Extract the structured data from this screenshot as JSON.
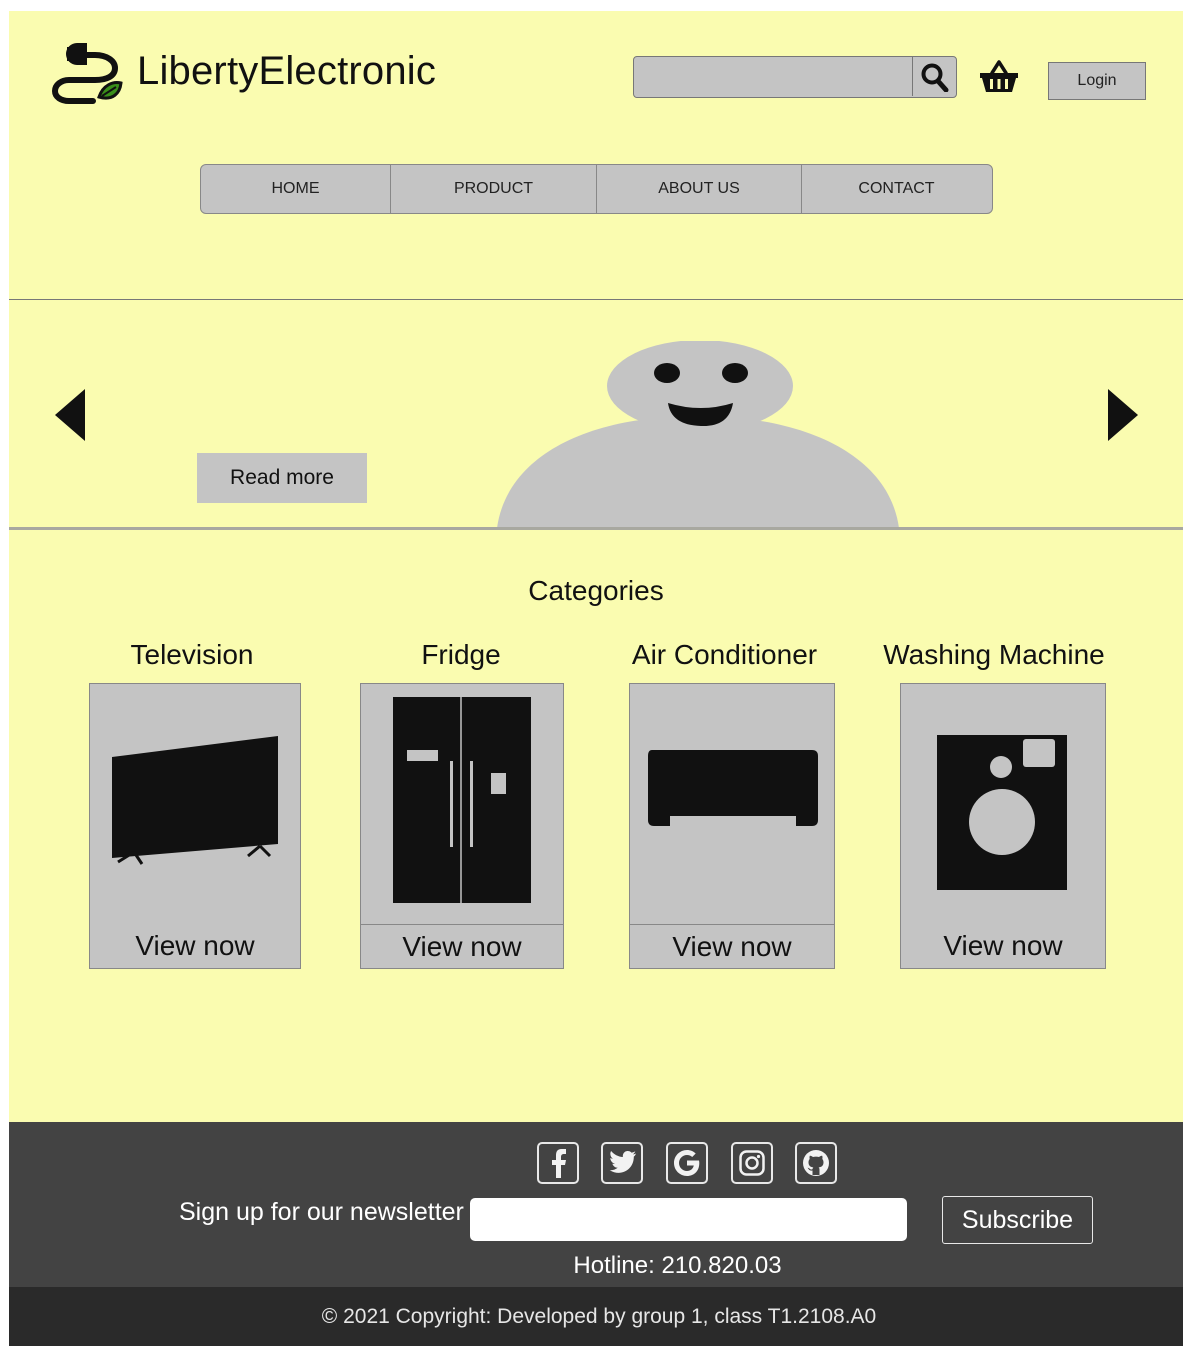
{
  "brand": {
    "name": "LibertyElectronic",
    "accent_color": "#3a8f1a",
    "logo_icon": "plug-leaf-icon"
  },
  "header": {
    "search_placeholder": "",
    "search_icon": "search-icon",
    "cart_icon": "basket-icon",
    "login_label": "Login"
  },
  "nav": {
    "items": [
      {
        "label": "HOME"
      },
      {
        "label": "PRODUCT"
      },
      {
        "label": "ABOUT US"
      },
      {
        "label": "CONTACT"
      }
    ]
  },
  "hero": {
    "read_more_label": "Read more",
    "prev_icon": "arrow-left-icon",
    "next_icon": "arrow-right-icon"
  },
  "categories": {
    "heading": "Categories",
    "items": [
      {
        "label": "Television",
        "cta": "View now",
        "icon": "television-icon"
      },
      {
        "label": "Fridge",
        "cta": "View now",
        "icon": "fridge-icon"
      },
      {
        "label": "Air Conditioner",
        "cta": "View now",
        "icon": "air-conditioner-icon"
      },
      {
        "label": "Washing Machine",
        "cta": "View now",
        "icon": "washing-machine-icon"
      }
    ]
  },
  "footer": {
    "social_icons": [
      "facebook-icon",
      "twitter-icon",
      "google-icon",
      "instagram-icon",
      "github-icon"
    ],
    "newsletter_label": "Sign up for our newsletter",
    "newsletter_placeholder": "",
    "subscribe_label": "Subscribe",
    "hotline": "Hotline: 210.820.03",
    "copyright": "© 2021 Copyright: Developed by group 1, class T1.2108.A0"
  },
  "colors": {
    "page_background": "#fafcb0",
    "panel_gray": "#c4c4c4",
    "footer_dark": "#434343",
    "footer_darker": "#2a2a2a"
  }
}
